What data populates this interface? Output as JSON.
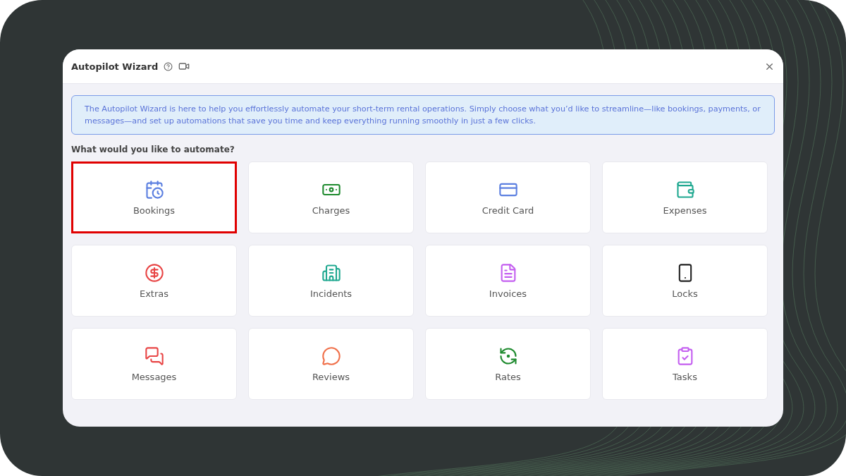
{
  "dialog": {
    "title": "Autopilot Wizard",
    "info": "The Autopilot Wizard is here to help you effortlessly automate your short-term rental operations. Simply choose what you’d like to streamline—like bookings, payments, or messages—and set up automations that save you time and keep everything running smoothly in just a few clicks.",
    "question": "What would you like to automate?"
  },
  "options": [
    {
      "label": "Bookings",
      "color": "#5b7fe0",
      "highlighted": true
    },
    {
      "label": "Charges",
      "color": "#1e8a2e",
      "highlighted": false
    },
    {
      "label": "Credit Card",
      "color": "#5b7fe0",
      "highlighted": false
    },
    {
      "label": "Expenses",
      "color": "#1fa890",
      "highlighted": false
    },
    {
      "label": "Extras",
      "color": "#e84545",
      "highlighted": false
    },
    {
      "label": "Incidents",
      "color": "#1fa890",
      "highlighted": false
    },
    {
      "label": "Invoices",
      "color": "#c45ff0",
      "highlighted": false
    },
    {
      "label": "Locks",
      "color": "#222222",
      "highlighted": false
    },
    {
      "label": "Messages",
      "color": "#e84545",
      "highlighted": false
    },
    {
      "label": "Reviews",
      "color": "#f0704a",
      "highlighted": false
    },
    {
      "label": "Rates",
      "color": "#1e8a2e",
      "highlighted": false
    },
    {
      "label": "Tasks",
      "color": "#c45ff0",
      "highlighted": false
    }
  ]
}
